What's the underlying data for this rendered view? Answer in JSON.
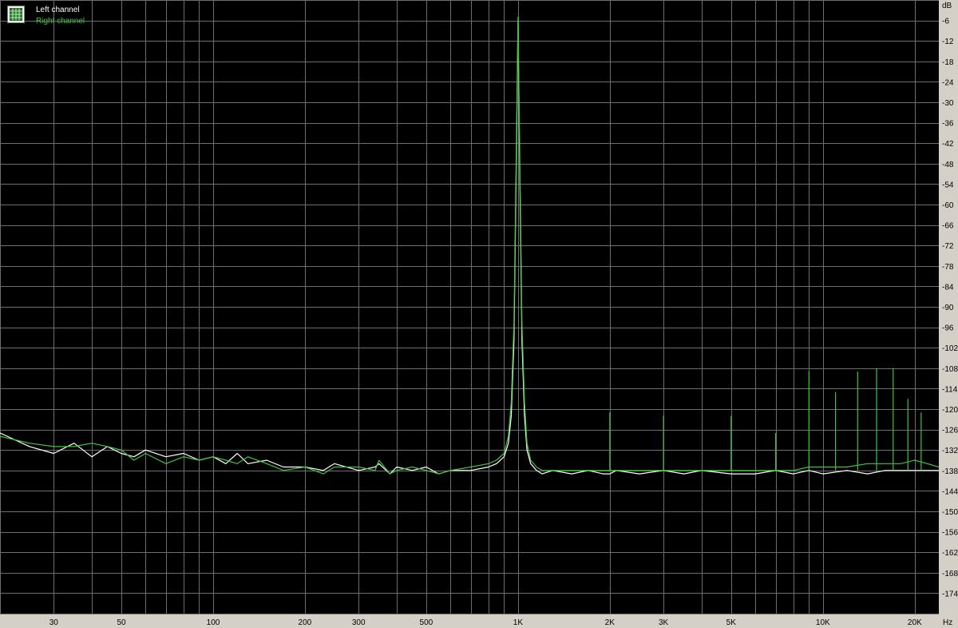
{
  "chart_data": {
    "type": "line",
    "xscale": "log",
    "xlim": [
      20,
      24000
    ],
    "ylim": [
      -180,
      0
    ],
    "y_unit": "dB",
    "x_unit": "Hz",
    "grid": true,
    "legend_placement": "top-left",
    "background_color": "#000000",
    "grid_color": "#6e6e6e",
    "x_ticks": [
      {
        "value": 30,
        "label": "30"
      },
      {
        "value": 50,
        "label": "50"
      },
      {
        "value": 100,
        "label": "100"
      },
      {
        "value": 200,
        "label": "200"
      },
      {
        "value": 300,
        "label": "300"
      },
      {
        "value": 500,
        "label": "500"
      },
      {
        "value": 1000,
        "label": "1K"
      },
      {
        "value": 2000,
        "label": "2K"
      },
      {
        "value": 3000,
        "label": "3K"
      },
      {
        "value": 5000,
        "label": "5K"
      },
      {
        "value": 10000,
        "label": "10K"
      },
      {
        "value": 20000,
        "label": "20K"
      }
    ],
    "y_ticks": [
      -6,
      -12,
      -18,
      -24,
      -30,
      -36,
      -42,
      -48,
      -54,
      -60,
      -66,
      -72,
      -78,
      -84,
      -90,
      -96,
      -102,
      -108,
      -114,
      -120,
      -126,
      -132,
      -138,
      -144,
      -150,
      -156,
      -162,
      -168,
      -174
    ],
    "series": [
      {
        "name": "Left channel",
        "color": "#ffffff",
        "x": [
          20,
          25,
          30,
          35,
          40,
          45,
          50,
          55,
          60,
          70,
          80,
          90,
          100,
          110,
          120,
          130,
          150,
          170,
          200,
          230,
          250,
          300,
          340,
          350,
          380,
          400,
          450,
          500,
          550,
          600,
          700,
          800,
          850,
          900,
          930,
          950,
          970,
          990,
          1000,
          1010,
          1030,
          1050,
          1070,
          1100,
          1150,
          1200,
          1300,
          1500,
          1700,
          1900,
          2000,
          2100,
          2500,
          3000,
          3500,
          4000,
          5000,
          6000,
          7000,
          8000,
          9000,
          10000,
          12000,
          14000,
          16000,
          18000,
          20000,
          22000,
          24000
        ],
        "y": [
          -127,
          -131,
          -133,
          -130,
          -134,
          -131,
          -133,
          -134,
          -132,
          -134,
          -133,
          -135,
          -134,
          -136,
          -133,
          -136,
          -135,
          -137,
          -137,
          -138,
          -136,
          -138,
          -137,
          -136,
          -139,
          -137,
          -138,
          -137,
          -139,
          -138,
          -138,
          -137,
          -136,
          -134,
          -130,
          -122,
          -100,
          -40,
          -6,
          -40,
          -100,
          -122,
          -132,
          -136,
          -138,
          -139,
          -138,
          -139,
          -138,
          -139,
          -139,
          -138,
          -139,
          -138,
          -139,
          -138,
          -139,
          -139,
          -138,
          -139,
          -138,
          -139,
          -138,
          -139,
          -138,
          -138,
          -138,
          -138,
          -138
        ]
      },
      {
        "name": "Right channel",
        "color": "#3ec43e",
        "x": [
          20,
          25,
          30,
          35,
          40,
          45,
          50,
          55,
          60,
          70,
          80,
          90,
          100,
          110,
          120,
          130,
          150,
          170,
          200,
          230,
          250,
          300,
          340,
          350,
          380,
          400,
          450,
          500,
          550,
          600,
          700,
          800,
          850,
          900,
          930,
          950,
          970,
          990,
          1000,
          1010,
          1030,
          1050,
          1070,
          1100,
          1150,
          1200,
          1300,
          1500,
          1700,
          1900,
          2000,
          2100,
          2500,
          3000,
          3500,
          4000,
          5000,
          6000,
          7000,
          8000,
          9000,
          10000,
          12000,
          14000,
          16000,
          18000,
          20000,
          22000,
          24000
        ],
        "y": [
          -128,
          -130,
          -131,
          -131,
          -130,
          -131,
          -132,
          -135,
          -133,
          -136,
          -134,
          -135,
          -134,
          -135,
          -136,
          -134,
          -136,
          -138,
          -137,
          -139,
          -137,
          -137,
          -138,
          -135,
          -139,
          -138,
          -137,
          -138,
          -139,
          -138,
          -137,
          -136,
          -135,
          -133,
          -128,
          -118,
          -95,
          -35,
          -5,
          -35,
          -95,
          -118,
          -130,
          -135,
          -137,
          -138,
          -138,
          -138,
          -138,
          -138,
          -138,
          -138,
          -138,
          -138,
          -138,
          -138,
          -138,
          -138,
          -138,
          -138,
          -137,
          -137,
          -137,
          -136,
          -136,
          -136,
          -135,
          -136,
          -137
        ]
      }
    ],
    "harmonic_spikes_right": [
      {
        "x": 2000,
        "y": -121
      },
      {
        "x": 3000,
        "y": -122
      },
      {
        "x": 5000,
        "y": -122
      },
      {
        "x": 7000,
        "y": -127
      },
      {
        "x": 9000,
        "y": -109
      },
      {
        "x": 11000,
        "y": -115
      },
      {
        "x": 13000,
        "y": -109
      },
      {
        "x": 15000,
        "y": -108
      },
      {
        "x": 17000,
        "y": -108
      },
      {
        "x": 19000,
        "y": -117
      },
      {
        "x": 21000,
        "y": -121
      }
    ]
  },
  "legend": {
    "icon": "chart-window-icon",
    "items": [
      {
        "label": "Left channel",
        "color": "#ffffff"
      },
      {
        "label": "Right channel",
        "color": "#3ec43e"
      }
    ]
  }
}
